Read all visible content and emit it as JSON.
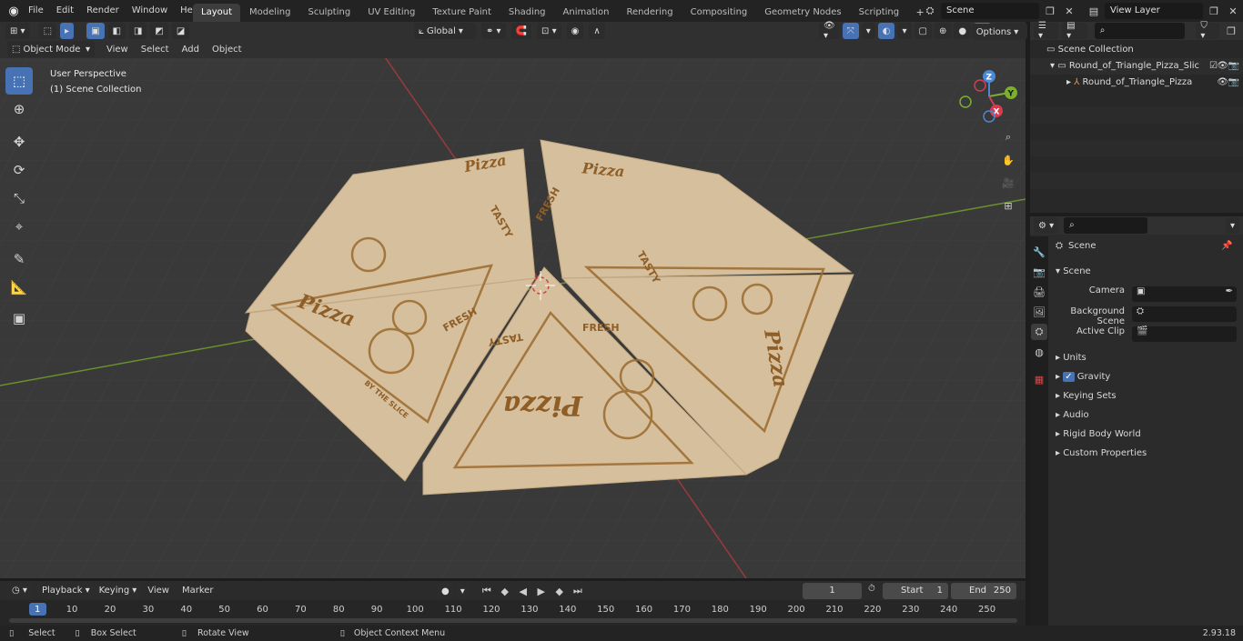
{
  "menu": [
    "File",
    "Edit",
    "Render",
    "Window",
    "Help"
  ],
  "workspaces": [
    "Layout",
    "Modeling",
    "Sculpting",
    "UV Editing",
    "Texture Paint",
    "Shading",
    "Animation",
    "Rendering",
    "Compositing",
    "Geometry Nodes",
    "Scripting"
  ],
  "active_workspace": "Layout",
  "scene_field": "Scene",
  "view_layer_field": "View Layer",
  "viewport_header": {
    "mode": "Object Mode",
    "view": "View",
    "select": "Select",
    "add": "Add",
    "object": "Object",
    "transform": "Global",
    "options": "Options"
  },
  "viewport_overlay": {
    "perspective": "User Perspective",
    "collection": "(1) Scene Collection"
  },
  "gizmo": {
    "z": "Z",
    "y": "Y",
    "x": "X"
  },
  "outliner": {
    "root": "Scene Collection",
    "items": [
      {
        "label": "Round_of_Triangle_Pizza_Slic"
      },
      {
        "label": "Round_of_Triangle_Pizza"
      }
    ]
  },
  "properties": {
    "header": "Scene",
    "section": "Scene",
    "camera_label": "Camera",
    "background_label": "Background Scene",
    "clip_label": "Active Clip",
    "panels": [
      "Units",
      "Gravity",
      "Keying Sets",
      "Audio",
      "Rigid Body World",
      "Custom Properties"
    ]
  },
  "pizza_text": {
    "brand": "Pizza",
    "fresh": "FRESH",
    "tasty": "TASTY",
    "slice": "BY THE SLICE"
  },
  "timeline": {
    "playback": "Playback",
    "keying": "Keying",
    "view": "View",
    "marker": "Marker",
    "current_frame": "1",
    "start_label": "Start",
    "start": "1",
    "end_label": "End",
    "end": "250",
    "ticks": [
      "1",
      "10",
      "20",
      "30",
      "40",
      "50",
      "60",
      "70",
      "80",
      "90",
      "100",
      "110",
      "120",
      "130",
      "140",
      "150",
      "160",
      "170",
      "180",
      "190",
      "200",
      "210",
      "220",
      "230",
      "240",
      "250"
    ]
  },
  "status": {
    "select": "Select",
    "box_select": "Box Select",
    "rotate": "Rotate View",
    "context": "Object Context Menu",
    "version": "2.93.18"
  }
}
